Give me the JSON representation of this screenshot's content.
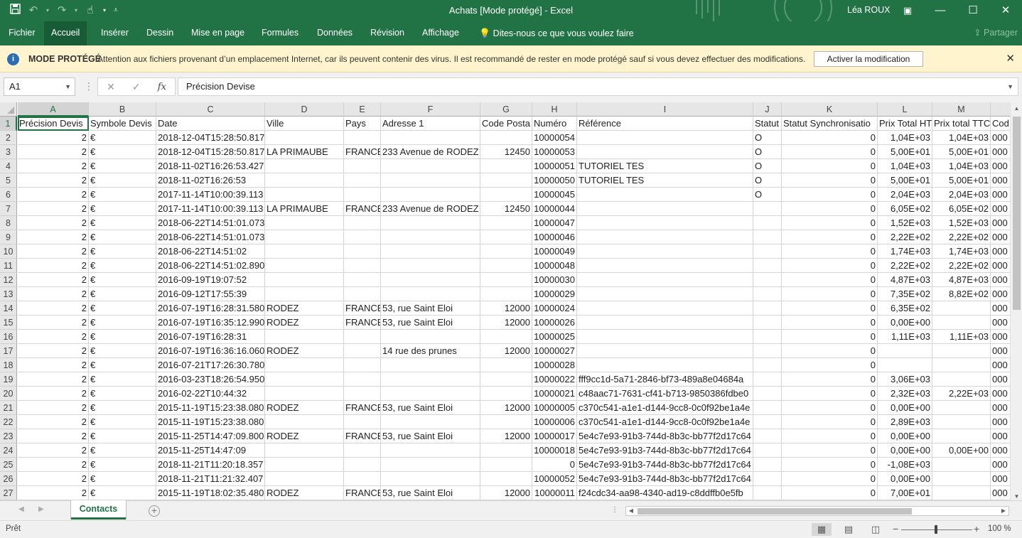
{
  "window": {
    "title": "Achats  [Mode protégé]  -  Excel",
    "user": "Léa ROUX",
    "buttons": {
      "minimize": "—",
      "maximize": "☐",
      "close": "✕"
    }
  },
  "ribbon": {
    "tabs": [
      "Fichier",
      "Accueil",
      "Insérer",
      "Dessin",
      "Mise en page",
      "Formules",
      "Données",
      "Révision",
      "Affichage"
    ],
    "active_tab": "Accueil",
    "tell_me": "Dites-nous ce que vous voulez faire",
    "share": "Partager"
  },
  "protected_view": {
    "title": "MODE PROTÉGÉ",
    "message": "Attention aux fichiers provenant d’un emplacement Internet, car ils peuvent contenir des virus. Il est recommandé de rester en mode protégé sauf si vous devez effectuer des modifications.",
    "button": "Activer la modification"
  },
  "formula_bar": {
    "name_box": "A1",
    "content": "Précision Devise"
  },
  "grid": {
    "columns": [
      "A",
      "B",
      "C",
      "D",
      "E",
      "F",
      "G",
      "H",
      "I",
      "J",
      "K",
      "L",
      "M",
      ""
    ],
    "selected_column": "A",
    "selected_row": "1",
    "rows": [
      {
        "n": "1",
        "cells": [
          "Précision Devis",
          "Symbole Devis",
          "Date",
          "Ville",
          "Pays",
          "Adresse 1",
          "Code Posta",
          "Numéro",
          "Référence",
          "Statut",
          "Statut Synchronisatio",
          "Prix Total HT",
          "Prix total TTC",
          "Cod"
        ]
      },
      {
        "n": "2",
        "cells": [
          "2",
          "€",
          "2018-12-04T15:28:50.817",
          "",
          "",
          "",
          "",
          "10000054",
          "",
          "O",
          "0",
          "1,04E+03",
          "1,04E+03",
          "000"
        ]
      },
      {
        "n": "3",
        "cells": [
          "2",
          "€",
          "2018-12-04T15:28:50.817",
          "LA PRIMAUBE",
          "FRANCE",
          "233 Avenue de RODEZ",
          "12450",
          "10000053",
          "",
          "O",
          "0",
          "5,00E+01",
          "5,00E+01",
          "000"
        ]
      },
      {
        "n": "4",
        "cells": [
          "2",
          "€",
          "2018-11-02T16:26:53.427",
          "",
          "",
          "",
          "",
          "10000051",
          "TUTORIEL TES",
          "O",
          "0",
          "1,04E+03",
          "1,04E+03",
          "000"
        ]
      },
      {
        "n": "5",
        "cells": [
          "2",
          "€",
          "2018-11-02T16:26:53",
          "",
          "",
          "",
          "",
          "10000050",
          "TUTORIEL TES",
          "O",
          "0",
          "5,00E+01",
          "5,00E+01",
          "000"
        ]
      },
      {
        "n": "6",
        "cells": [
          "2",
          "€",
          "2017-11-14T10:00:39.113",
          "",
          "",
          "",
          "",
          "10000045",
          "",
          "O",
          "0",
          "2,04E+03",
          "2,04E+03",
          "000"
        ]
      },
      {
        "n": "7",
        "cells": [
          "2",
          "€",
          "2017-11-14T10:00:39.113",
          "LA PRIMAUBE",
          "FRANCE",
          "233 Avenue de RODEZ",
          "12450",
          "10000044",
          "",
          "",
          "0",
          "6,05E+02",
          "6,05E+02",
          "000"
        ]
      },
      {
        "n": "8",
        "cells": [
          "2",
          "€",
          "2018-06-22T14:51:01.073",
          "",
          "",
          "",
          "",
          "10000047",
          "",
          "",
          "0",
          "1,52E+03",
          "1,52E+03",
          "000"
        ]
      },
      {
        "n": "9",
        "cells": [
          "2",
          "€",
          "2018-06-22T14:51:01.073",
          "",
          "",
          "",
          "",
          "10000046",
          "",
          "",
          "0",
          "2,22E+02",
          "2,22E+02",
          "000"
        ]
      },
      {
        "n": "10",
        "cells": [
          "2",
          "€",
          "2018-06-22T14:51:02",
          "",
          "",
          "",
          "",
          "10000049",
          "",
          "",
          "0",
          "1,74E+03",
          "1,74E+03",
          "000"
        ]
      },
      {
        "n": "11",
        "cells": [
          "2",
          "€",
          "2018-06-22T14:51:02.890",
          "",
          "",
          "",
          "",
          "10000048",
          "",
          "",
          "0",
          "2,22E+02",
          "2,22E+02",
          "000"
        ]
      },
      {
        "n": "12",
        "cells": [
          "2",
          "€",
          "2016-09-19T19:07:52",
          "",
          "",
          "",
          "",
          "10000030",
          "",
          "",
          "0",
          "4,87E+03",
          "4,87E+03",
          "000"
        ]
      },
      {
        "n": "13",
        "cells": [
          "2",
          "€",
          "2016-09-12T17:55:39",
          "",
          "",
          "",
          "",
          "10000029",
          "",
          "",
          "0",
          "7,35E+02",
          "8,82E+02",
          "000"
        ]
      },
      {
        "n": "14",
        "cells": [
          "2",
          "€",
          "2016-07-19T16:28:31.580",
          "RODEZ",
          "FRANCE",
          "53, rue Saint Eloi",
          "12000",
          "10000024",
          "",
          "",
          "0",
          "6,35E+02",
          "",
          "000"
        ]
      },
      {
        "n": "15",
        "cells": [
          "2",
          "€",
          "2016-07-19T16:35:12.990",
          "RODEZ",
          "FRANCE",
          "53, rue Saint Eloi",
          "12000",
          "10000026",
          "",
          "",
          "0",
          "0,00E+00",
          "",
          "000"
        ]
      },
      {
        "n": "16",
        "cells": [
          "2",
          "€",
          "2016-07-19T16:28:31",
          "",
          "",
          "",
          "",
          "10000025",
          "",
          "",
          "0",
          "1,11E+03",
          "1,11E+03",
          "000"
        ]
      },
      {
        "n": "17",
        "cells": [
          "2",
          "€",
          "2016-07-19T16:36:16.060",
          "RODEZ",
          "",
          "14 rue des prunes",
          "12000",
          "10000027",
          "",
          "",
          "0",
          "",
          "",
          "000"
        ]
      },
      {
        "n": "18",
        "cells": [
          "2",
          "€",
          "2016-07-21T17:26:30.780",
          "",
          "",
          "",
          "",
          "10000028",
          "",
          "",
          "0",
          "",
          "",
          "000"
        ]
      },
      {
        "n": "19",
        "cells": [
          "2",
          "€",
          "2016-03-23T18:26:54.950",
          "",
          "",
          "",
          "",
          "10000022",
          "fff9cc1d-5a71-2846-bf73-489a8e04684a",
          "",
          "0",
          "3,06E+03",
          "",
          "000"
        ]
      },
      {
        "n": "20",
        "cells": [
          "2",
          "€",
          "2016-02-22T10:44:32",
          "",
          "",
          "",
          "",
          "10000021",
          "c48aac71-7631-cf41-b713-9850386fdbe0",
          "",
          "0",
          "2,32E+03",
          "2,22E+03",
          "000"
        ]
      },
      {
        "n": "21",
        "cells": [
          "2",
          "€",
          "2015-11-19T15:23:38.080",
          "RODEZ",
          "FRANCE",
          "53, rue Saint Eloi",
          "12000",
          "10000005",
          "c370c541-a1e1-d144-9cc8-0c0f92be1a4e",
          "",
          "0",
          "0,00E+00",
          "",
          "000"
        ]
      },
      {
        "n": "22",
        "cells": [
          "2",
          "€",
          "2015-11-19T15:23:38.080",
          "",
          "",
          "",
          "",
          "10000006",
          "c370c541-a1e1-d144-9cc8-0c0f92be1a4e",
          "",
          "0",
          "2,89E+03",
          "",
          "000"
        ]
      },
      {
        "n": "23",
        "cells": [
          "2",
          "€",
          "2015-11-25T14:47:09.800",
          "RODEZ",
          "FRANCE",
          "53, rue Saint Eloi",
          "12000",
          "10000017",
          "5e4c7e93-91b3-744d-8b3c-bb77f2d17c64",
          "",
          "0",
          "0,00E+00",
          "",
          "000"
        ]
      },
      {
        "n": "24",
        "cells": [
          "2",
          "€",
          "2015-11-25T14:47:09",
          "",
          "",
          "",
          "",
          "10000018",
          "5e4c7e93-91b3-744d-8b3c-bb77f2d17c64",
          "",
          "0",
          "0,00E+00",
          "0,00E+00",
          "000"
        ]
      },
      {
        "n": "25",
        "cells": [
          "2",
          "€",
          "2018-11-21T11:20:18.357",
          "",
          "",
          "",
          "",
          "0",
          "5e4c7e93-91b3-744d-8b3c-bb77f2d17c64",
          "",
          "0",
          "-1,08E+03",
          "",
          "000"
        ]
      },
      {
        "n": "26",
        "cells": [
          "2",
          "€",
          "2018-11-21T11:21:32.407",
          "",
          "",
          "",
          "",
          "10000052",
          "5e4c7e93-91b3-744d-8b3c-bb77f2d17c64",
          "",
          "0",
          "0,00E+00",
          "",
          "000"
        ]
      },
      {
        "n": "27",
        "cells": [
          "2",
          "€",
          "2015-11-19T18:02:35.480",
          "RODEZ",
          "FRANCE",
          "53, rue Saint Eloi",
          "12000",
          "10000011",
          "f24cdc34-aa98-4340-ad19-c8ddffb0e5fb",
          "",
          "0",
          "7,00E+01",
          "",
          "000"
        ]
      }
    ]
  },
  "sheet_tabs": {
    "active": "Contacts"
  },
  "status_bar": {
    "status": "Prêt",
    "zoom": "100 %"
  }
}
